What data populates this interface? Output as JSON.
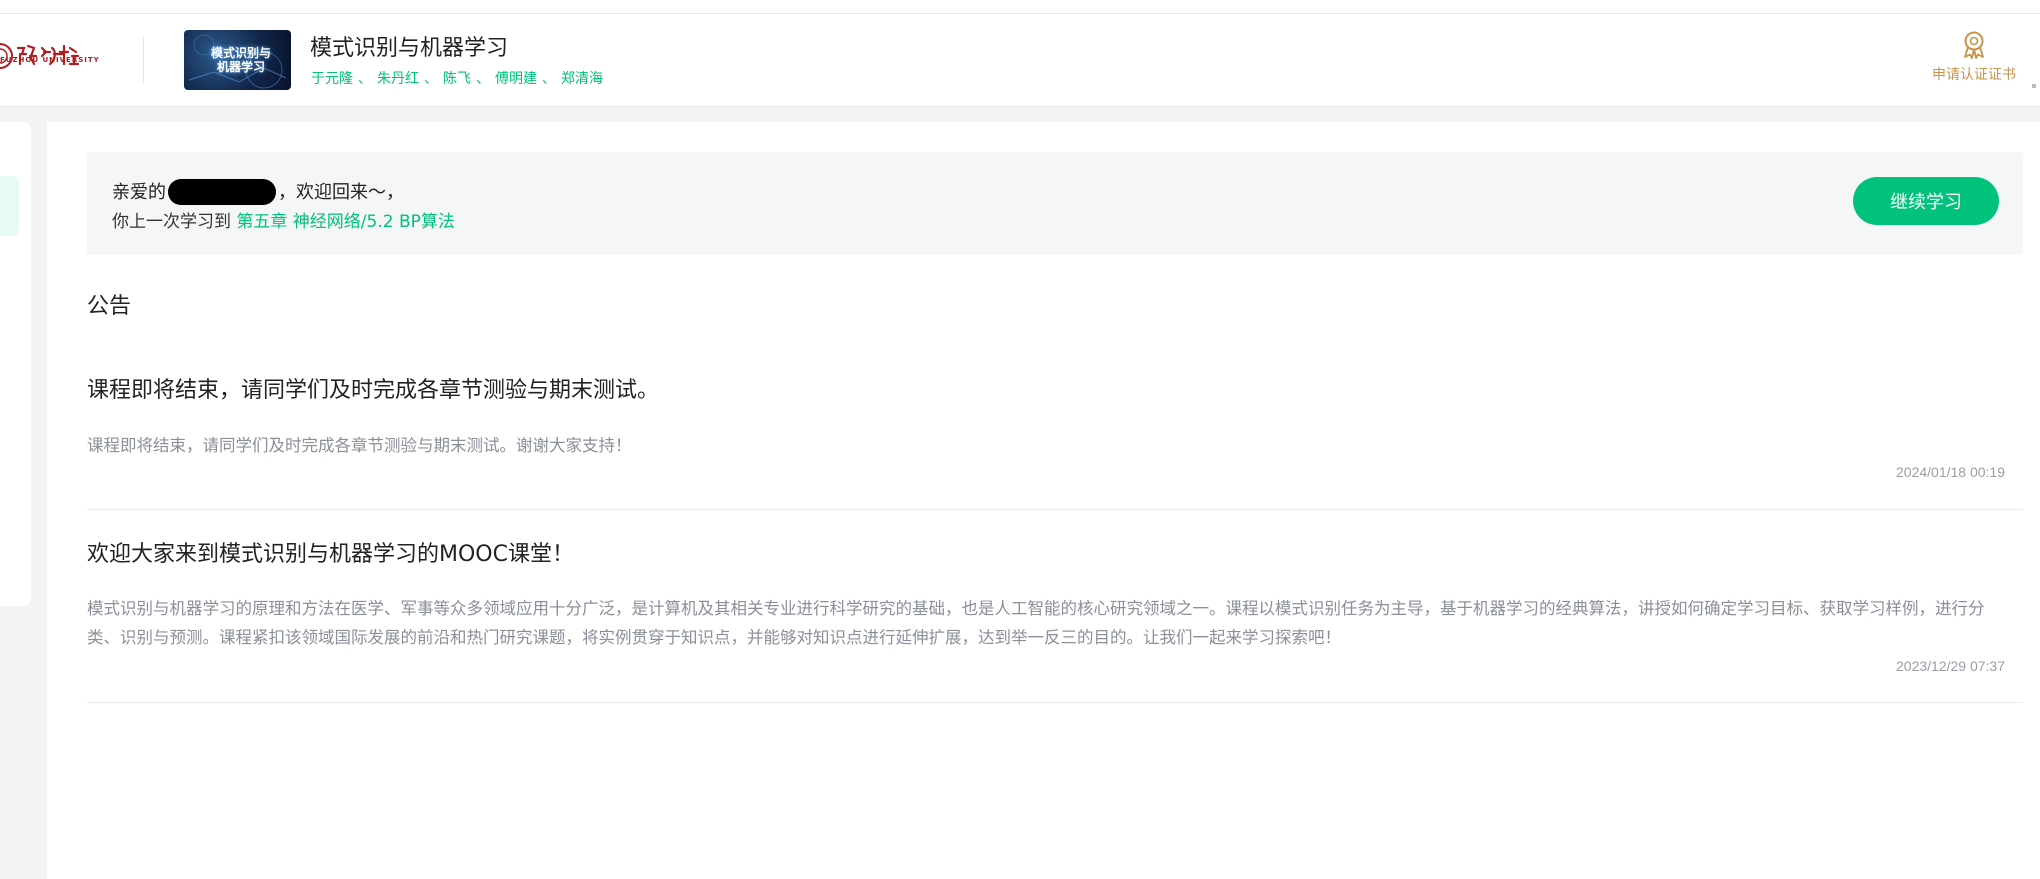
{
  "header": {
    "university_logo_text": "FUZHOU UNIVERSITY",
    "course_thumb_text": "模式识别与机器学习",
    "course_title": "模式识别与机器学习",
    "teachers": [
      "于元隆",
      "朱丹红",
      "陈飞",
      "傅明建",
      "郑清海"
    ],
    "teacher_separator": "、",
    "cert_label": "申请认证证书"
  },
  "welcome": {
    "greeting_prefix": "亲爱的",
    "greeting_suffix": "，欢迎回来～，",
    "last_study_prefix": "你上一次学习到",
    "last_study_link": "第五章 神经网络/5.2 BP算法",
    "continue_button": "继续学习"
  },
  "announcements": {
    "section_title": "公告",
    "items": [
      {
        "title": "课程即将结束，请同学们及时完成各章节测验与期末测试。",
        "body": "课程即将结束，请同学们及时完成各章节测验与期末测试。谢谢大家支持！",
        "date": "2024/01/18 00:19"
      },
      {
        "title": "欢迎大家来到模式识别与机器学习的MOOC课堂！",
        "body": "模式识别与机器学习的原理和方法在医学、军事等众多领域应用十分广泛，是计算机及其相关专业进行科学研究的基础，也是人工智能的核心研究领域之一。课程以模式识别任务为主导，基于机器学习的经典算法，讲授如何确定学习目标、获取学习样例，进行分类、识别与预测。课程紧扣该领域国际发展的前沿和热门研究课题，将实例贯穿于知识点，并能够对知识点进行延伸扩展，达到举一反三的目的。让我们一起来学习探索吧！",
        "date": "2023/12/29 07:37"
      }
    ]
  },
  "colors": {
    "accent_green": "#00c27a",
    "cert_gold": "#c8944b",
    "logo_red": "#b01d22"
  }
}
